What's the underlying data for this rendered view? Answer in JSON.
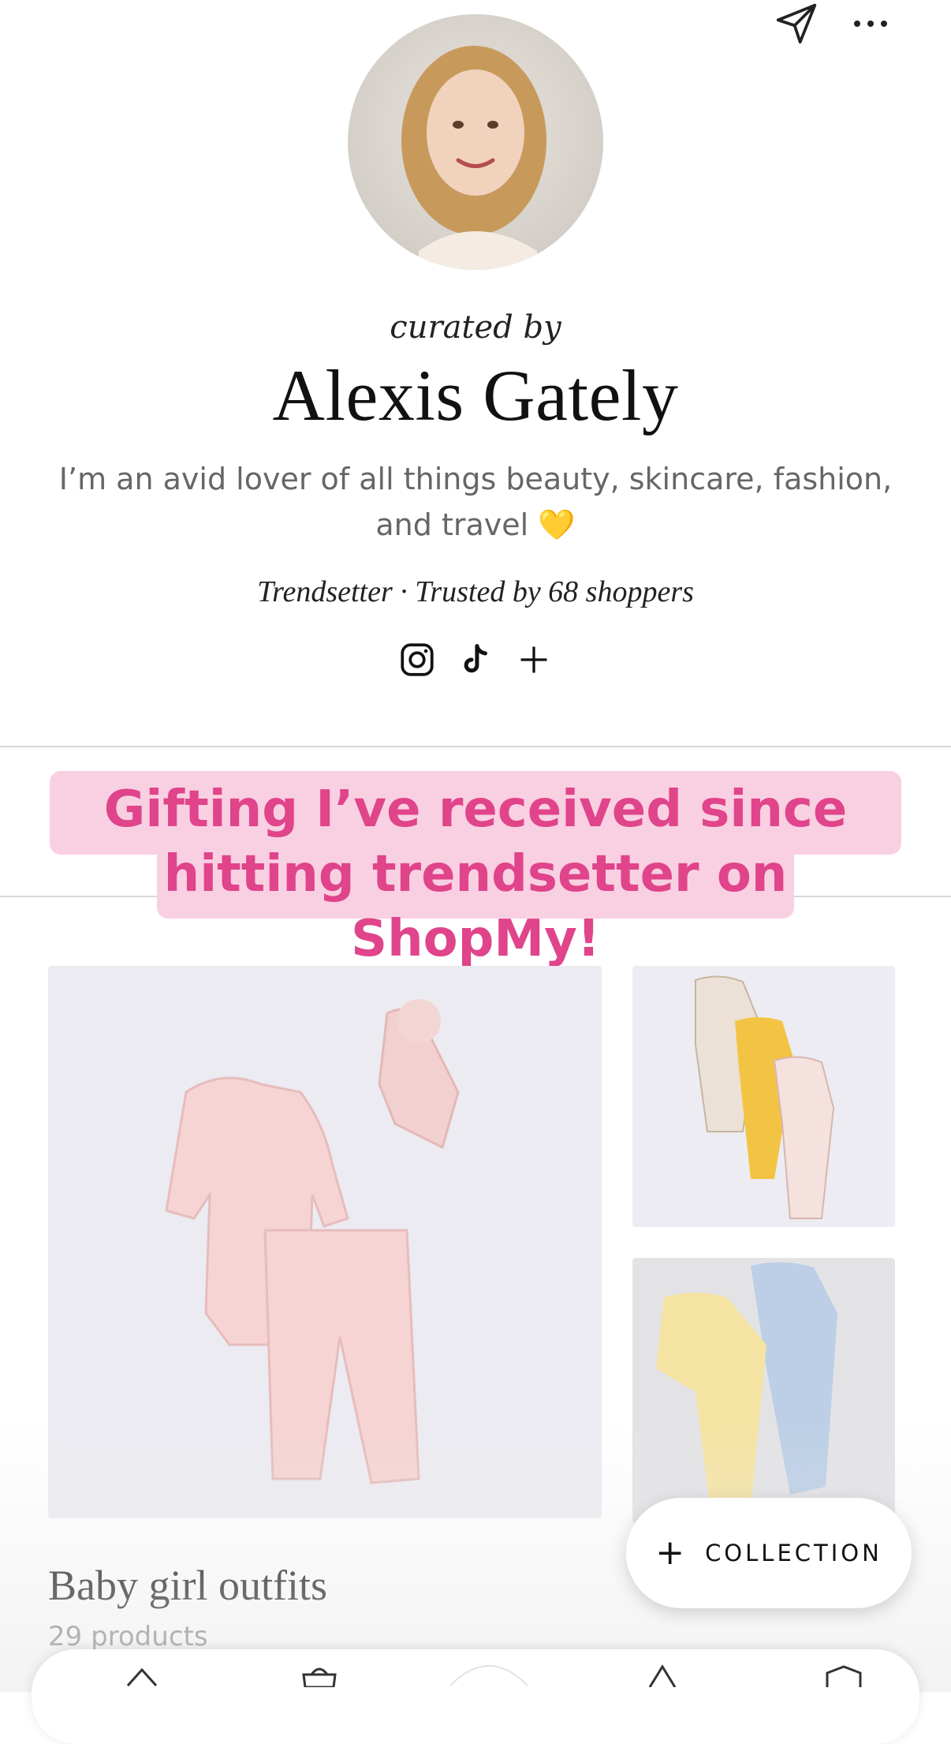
{
  "header": {
    "share_icon": "send-icon",
    "more_icon": "more-icon"
  },
  "profile": {
    "curated_label": "curated by",
    "name": "Alexis Gately",
    "bio": "I’m an avid lover of all things beauty, skincare, fashion, and travel 💛",
    "tier": "Trendsetter",
    "separator": "·",
    "trusted": "Trusted by 68 shoppers",
    "social_icons": [
      "instagram-icon",
      "tiktok-icon",
      "plus-icon"
    ]
  },
  "overlay": {
    "caption": "Gifting I’ve received since hitting trendsetter on ShopMy!"
  },
  "collection": {
    "title": "Baby girl outfits",
    "count": "29 products"
  },
  "fab": {
    "plus": "+",
    "label": "COLLECTION"
  },
  "bottom_nav": {
    "items": [
      "home-icon",
      "shop-icon",
      "center-icon",
      "alert-icon",
      "gift-icon"
    ]
  },
  "colors": {
    "caption_bg": "#f9d0e2",
    "caption_text": "#e0448a",
    "divider": "#d9d9d9"
  }
}
